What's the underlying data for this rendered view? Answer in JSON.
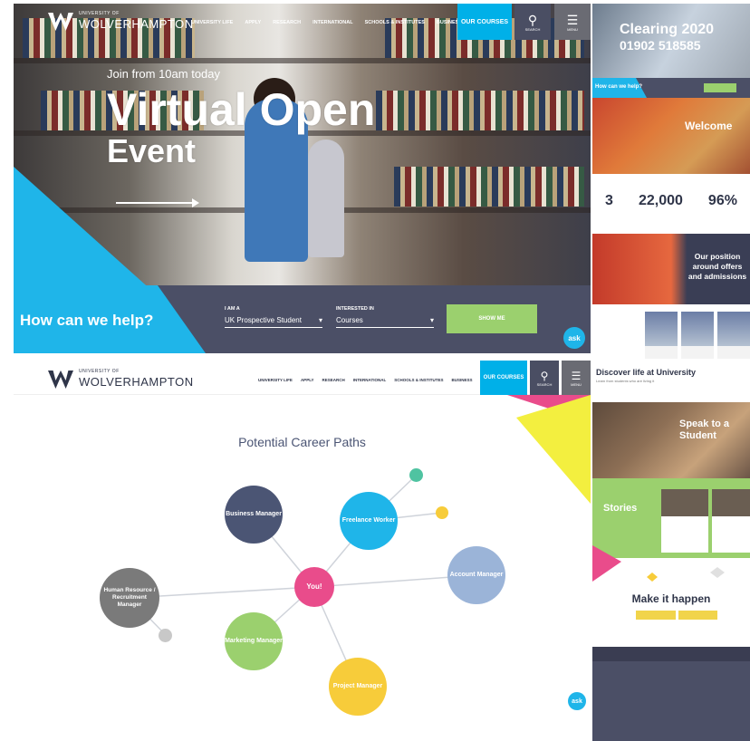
{
  "hero": {
    "brand_small": "UNIVERSITY OF",
    "brand": "WOLVERHAMPTON",
    "nav": [
      "UNIVERSITY LIFE",
      "APPLY",
      "RESEARCH",
      "INTERNATIONAL",
      "SCHOOLS & INSTITUTES",
      "BUSINESS"
    ],
    "courses_label": "OUR COURSES",
    "search_label": "SEARCH",
    "menu_label": "MENU",
    "subtitle": "Join from 10am today",
    "title_line1": "Virtual Open",
    "title_line2": "Event",
    "help_title": "How can we help?",
    "field1_label": "I AM A",
    "field1_value": "UK Prospective Student",
    "field2_label": "INTERESTED IN",
    "field2_value": "Courses",
    "show_me": "SHOW ME",
    "ask": "ask"
  },
  "career": {
    "title": "Potential Career Paths",
    "center": "You!",
    "nodes": {
      "business": "Business Manager",
      "freelance": "Freelance Worker",
      "account": "Account Manager",
      "hr": "Human Resource / Recruitment Manager",
      "marketing": "Marketing Manager",
      "project": "Project Manager"
    },
    "colors": {
      "center": "#e94c8b",
      "business": "#4b5574",
      "freelance": "#1fb5e9",
      "account": "#9bb4d8",
      "hr": "#7a7a7a",
      "marketing": "#9bd06e",
      "project": "#f7cc3a"
    },
    "ask": "ask"
  },
  "right": {
    "clearing_title": "Clearing 2020",
    "clearing_phone": "01902 518585",
    "help": "How can we help?",
    "welcome": "Welcome",
    "stats": [
      "3",
      "22,000",
      "96%"
    ],
    "position": "Our position around offers and admissions",
    "discover": "Discover life at University",
    "discover_sub": "Learn from students who are living it",
    "speak": "Speak to a Student",
    "stories": "Stories",
    "make": "Make it happen"
  }
}
